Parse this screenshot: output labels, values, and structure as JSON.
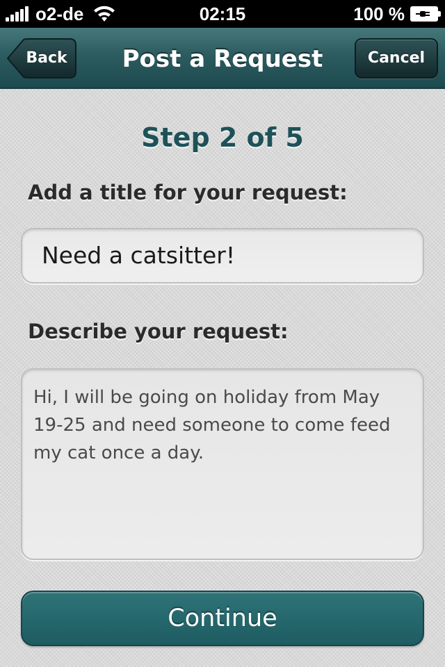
{
  "status_bar": {
    "carrier": "o2-de",
    "time": "02:15",
    "battery_percent": "100 %",
    "icons": [
      "signal-icon",
      "wifi-icon",
      "battery-charging-icon"
    ]
  },
  "nav": {
    "title": "Post a Request",
    "back_label": "Back",
    "cancel_label": "Cancel"
  },
  "form": {
    "step_label": "Step 2 of 5",
    "title_label": "Add a title for your request:",
    "title_value": "Need a catsitter!",
    "description_label": "Describe your request:",
    "description_value": "Hi, I will be going on holiday from May 19-25 and need someone to come feed my cat once a day.",
    "continue_label": "Continue"
  },
  "colors": {
    "nav_bar": "#2c5c60",
    "accent": "#1d5258",
    "continue_button": "#25686d"
  }
}
